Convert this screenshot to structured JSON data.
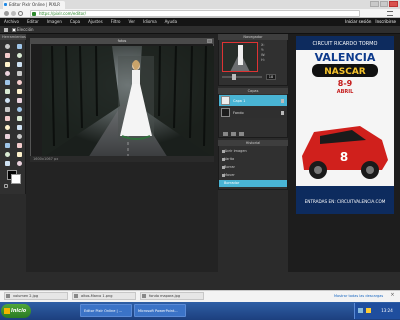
{
  "browser": {
    "tab_title": "Editor Pixlr Online | PIXLR",
    "url": "https://pixlr.com/editor/",
    "tab_icon": "pixlr-favicon-icon"
  },
  "app": {
    "menu": [
      "Archivo",
      "Editar",
      "Imagen",
      "Capa",
      "Ajustes",
      "Filtro",
      "Ver",
      "Idioma",
      "Ayuda"
    ],
    "account_links": [
      "Iniciar sesión",
      "Inscribirse"
    ],
    "options": {
      "autoselect_label": "Elección",
      "opacity_label": "Opacidad"
    }
  },
  "tools": {
    "title": "Herramientas",
    "icons": [
      "crop-icon",
      "move-icon",
      "marquee-icon",
      "lasso-icon",
      "wand-icon",
      "pencil-icon",
      "brush-icon",
      "eraser-icon",
      "bucket-icon",
      "gradient-icon",
      "clone-icon",
      "picker-icon",
      "drawing-icon",
      "red-eye-icon",
      "spot-heal-icon",
      "bloat-icon",
      "pinch-icon",
      "blur-icon",
      "sharpen-icon",
      "smudge-icon",
      "sponge-icon",
      "dodge-icon",
      "burn-icon",
      "type-icon",
      "hand-icon",
      "zoom-icon",
      "shape-icon",
      "swap-icon"
    ],
    "foreground": "#050505",
    "background": "#ffffff"
  },
  "document": {
    "title": "fotos",
    "status": "1600x1067 px"
  },
  "navigator": {
    "title": "Navegador",
    "x_label": "X:",
    "y_label": "Y:",
    "w_label": "W:",
    "h_label": "H:",
    "zoom": "18"
  },
  "layers": {
    "title": "Capas",
    "items": [
      {
        "name": "Capa 1",
        "selected": true
      },
      {
        "name": "Fondo",
        "selected": false
      }
    ]
  },
  "history": {
    "title": "Historial",
    "items": [
      "Abrir imagen",
      "Varita",
      "Borrar",
      "Mover",
      "Borrador"
    ],
    "active": "Borrador"
  },
  "ad": {
    "headline": "CIRCUIT RICARDO TORMO",
    "brand": "VALENCIA",
    "series": "NASCAR",
    "dates": "8-9",
    "month": "ABRIL",
    "car_number": "8",
    "tickets": "ENTRADAS EN: CIRCUITVALENCIA.COM"
  },
  "downloads": {
    "items": [
      "volumen 2.jpg",
      "altos-Marco 1.png",
      "fondo mapara.jpg"
    ],
    "show_all": "Mostrar todas las descargas",
    "close_icon": "close-icon"
  },
  "taskbar": {
    "start": "Inicio",
    "apps": [
      "Editor Pixlr Online | ...",
      "Microsoft PowerPoint..."
    ],
    "clock": "13:24",
    "colors": {
      "start": "#3a8f2e",
      "bar": "#2a5498"
    }
  },
  "colors": {
    "accent": "#49b4d4",
    "panel": "#303030",
    "workspace": "#232323"
  }
}
